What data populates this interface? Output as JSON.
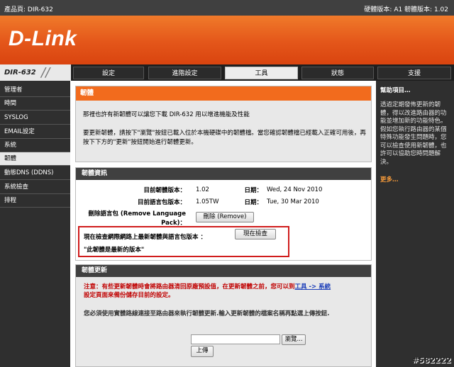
{
  "topbar": {
    "product": "產品頁: DIR-632",
    "versions": "硬體版本: A1    韌體版本: 1.02"
  },
  "brand": {
    "logo": "D-Link"
  },
  "model": "DIR-632",
  "tabs": [
    {
      "label": "設定"
    },
    {
      "label": "進階設定"
    },
    {
      "label": "工具"
    },
    {
      "label": "狀態"
    },
    {
      "label": "支援"
    }
  ],
  "sidebar": [
    {
      "label": "管理者"
    },
    {
      "label": "時間"
    },
    {
      "label": "SYSLOG"
    },
    {
      "label": "EMAIL設定"
    },
    {
      "label": "系統"
    },
    {
      "label": "韌體"
    },
    {
      "label": "動態DNS (DDNS)"
    },
    {
      "label": "系統檢查"
    },
    {
      "label": "排程"
    }
  ],
  "firmware": {
    "title": "韌體",
    "intro": "那裡也許有新韌體可以讓您下載 DIR-632 用以增進機能及性能",
    "instructions": "要更新韌體，請按下\"瀏覽\"按鈕已載入位於本機硬碟中的韌體檔。當您確認韌體檔已經載入正確可用後，再按下下方的\"更新\"按鈕開始進行韌體更新。"
  },
  "info": {
    "title": "韌體資訊",
    "fw_version_label": "目前韌體版本：",
    "fw_version": "1.02",
    "fw_date_label": "日期：",
    "fw_date": "Wed, 24 Nov 2010",
    "lang_version_label": "目前語言包版本：",
    "lang_version": "1.05TW",
    "lang_date_label": "日期：",
    "lang_date": "Tue, 30 Mar 2010",
    "remove_label_1": "刪除語言包 (Remove Language",
    "remove_label_2": "Pack)：",
    "remove_button": "刪除 (Remove)",
    "check_label": "現在檢查網際網路上最新韌體與語言包版本 ：",
    "check_button": "現在檢查",
    "latest_msg": "\"此韌體是最新的版本\""
  },
  "upgrade": {
    "title": "韌體更新",
    "note_prefix": "注意：",
    "note_text_1": "有些更新韌體時會將路由器清回原廠預設值，在更新韌體之前，您可以到",
    "note_link": "工具 -> 系統",
    "note_text_2": "設定頁面來備份儲存目前的設定。",
    "instr": "您必須使用實體路線連接至路由器來執行韌體更新.輸入更新韌體的檔案名稱再點選上傳按鈕.",
    "browse_button": "瀏覽...",
    "upload_button": "上傳"
  },
  "help": {
    "title": "幫助項目…",
    "text": "透過定期發佈更新的韌體，得以改進路由器的功能並增加新的功能特色。假如您執行路由器的某個特殊功能發生問題時，您可以檢查使用新韌體，也許可以協助您時問題解決。",
    "more": "更多…"
  },
  "watermark": "#582222"
}
